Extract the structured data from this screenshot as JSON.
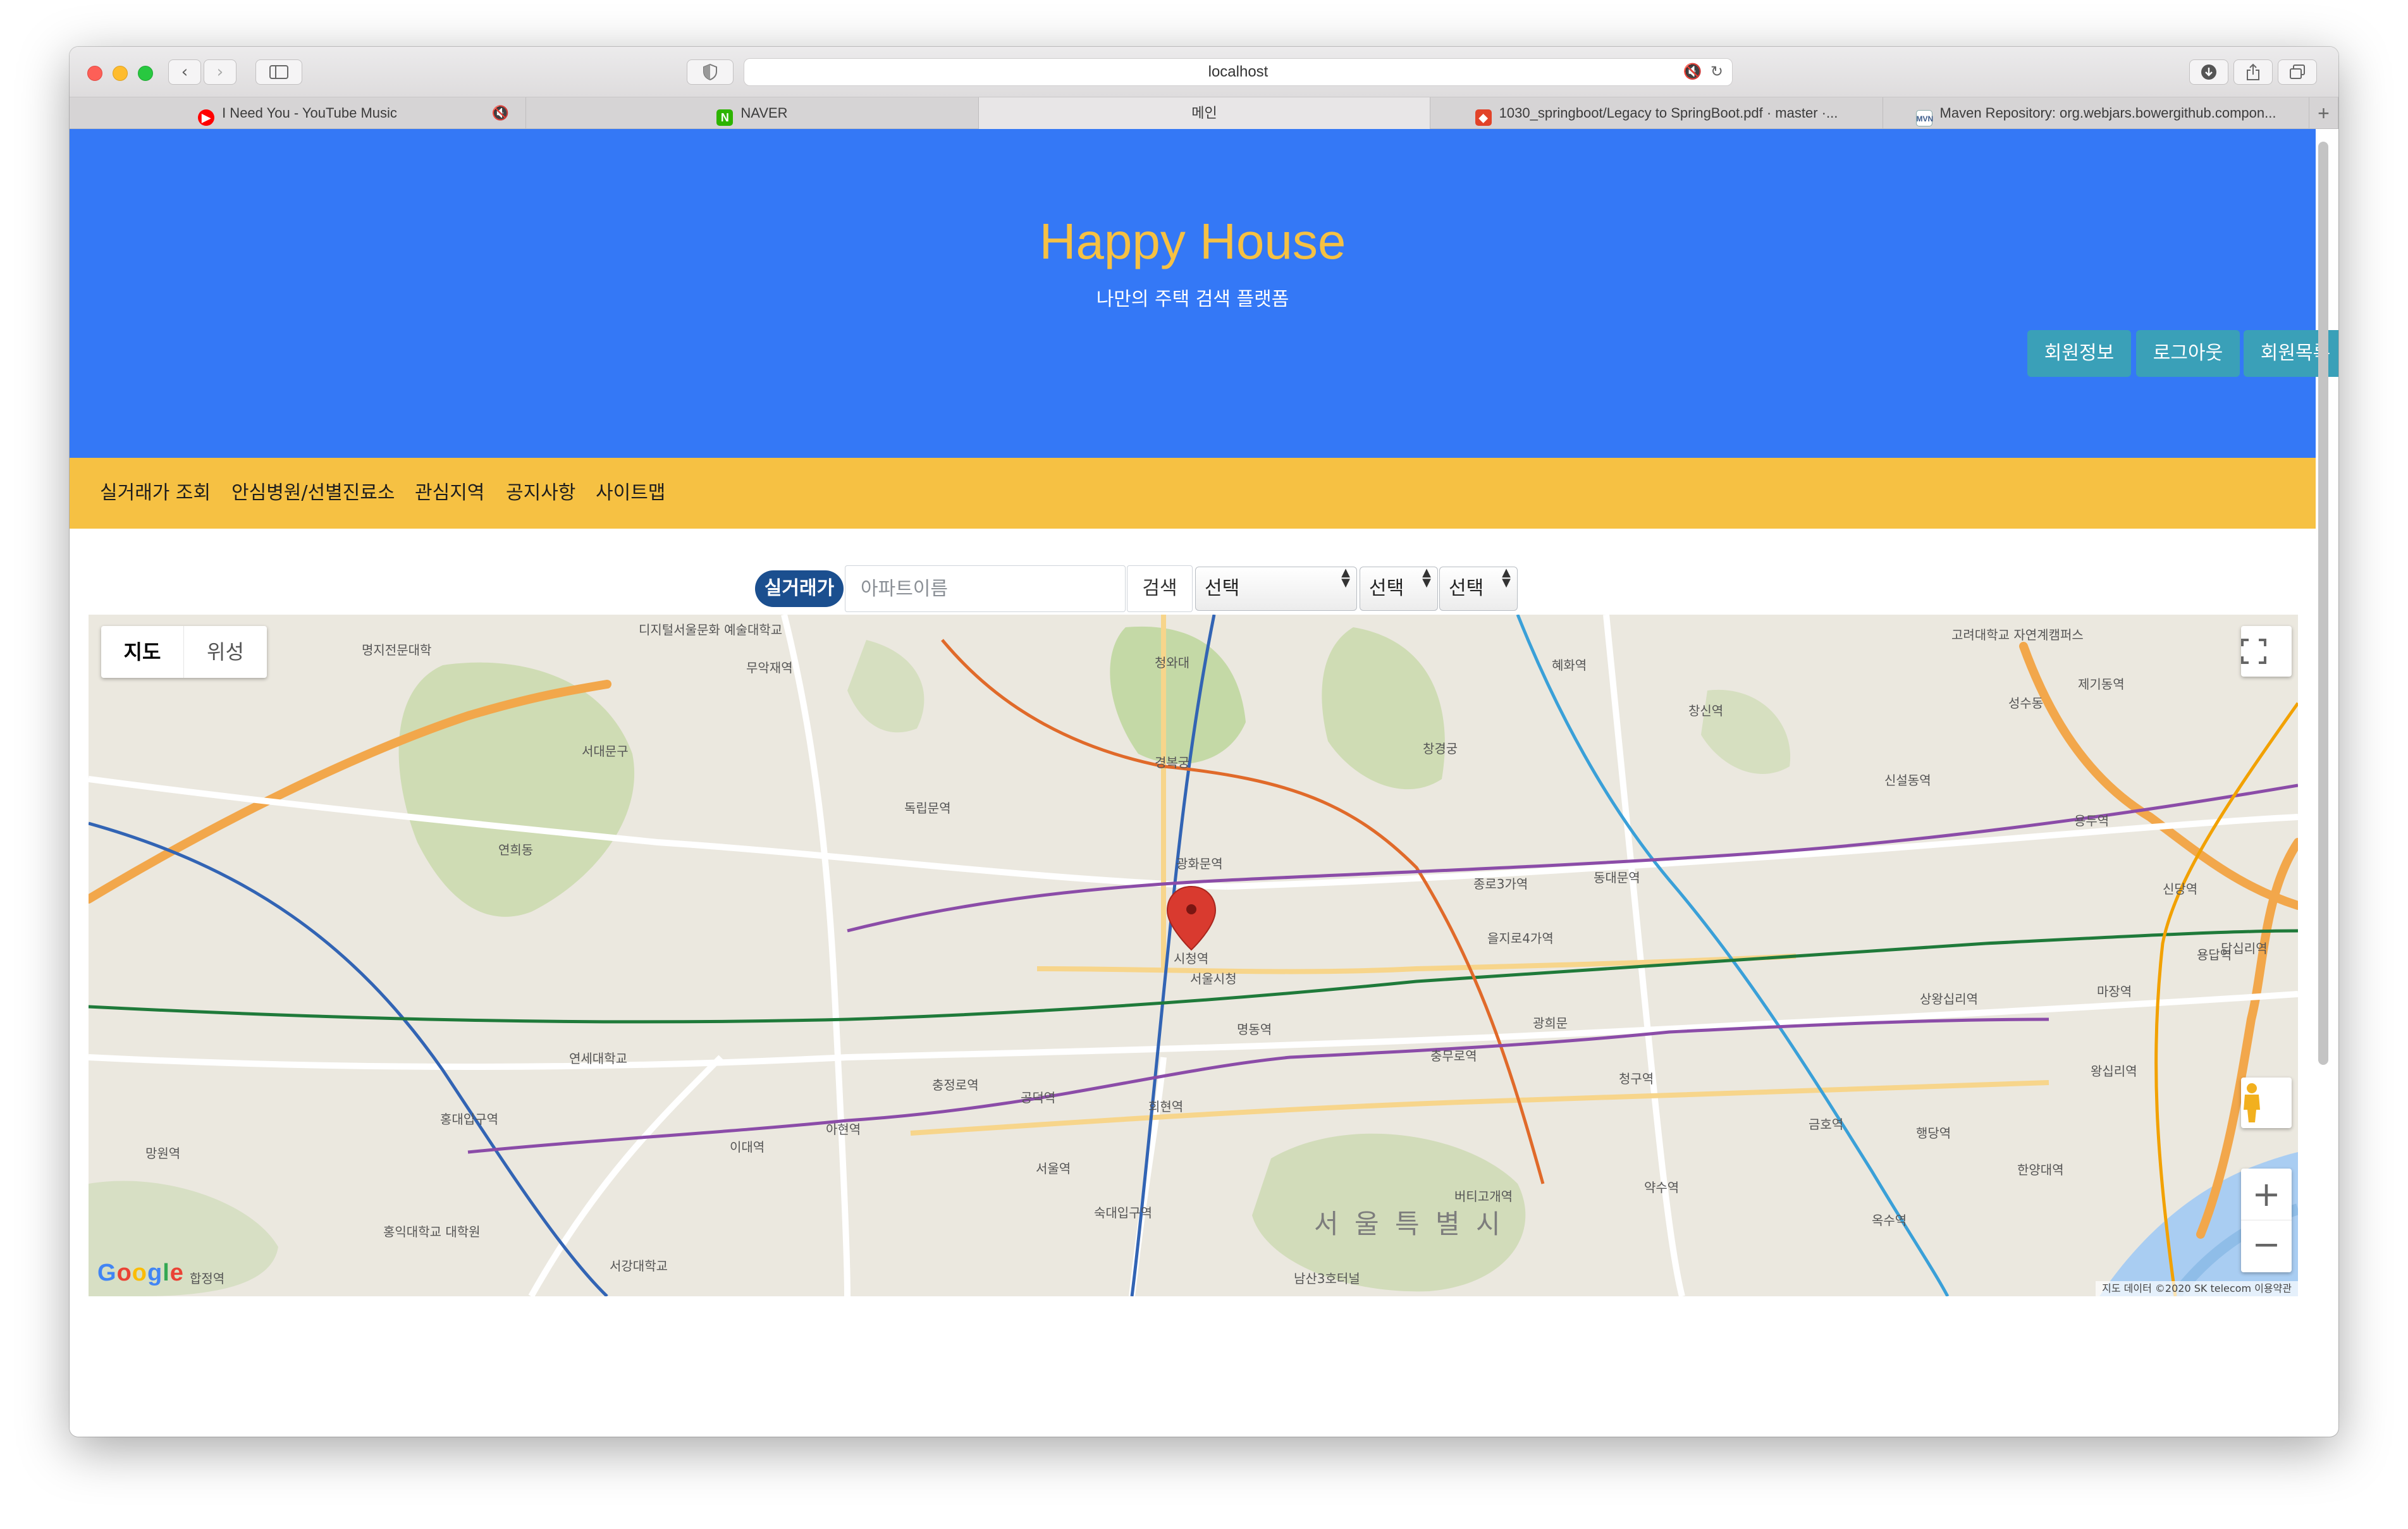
{
  "browser": {
    "address": "localhost",
    "tabs": [
      {
        "label": "I Need You - YouTube Music",
        "muted": true,
        "icon": "youtube-music-icon"
      },
      {
        "label": "NAVER",
        "icon": "naver-icon"
      },
      {
        "label": "메인",
        "active": true
      },
      {
        "label": "1030_springboot/Legacy to SpringBoot.pdf · master ·...",
        "icon": "gitlab-icon"
      },
      {
        "label": "Maven Repository: org.webjars.bowergithub.compon...",
        "icon": "maven-icon"
      }
    ]
  },
  "header": {
    "title": "Happy House",
    "subtitle": "나만의 주택 검색 플랫폼",
    "buttons": [
      "회원정보",
      "로그아웃",
      "회원목록"
    ]
  },
  "nav": {
    "items": [
      "실거래가 조회",
      "안심병원/선별진료소",
      "관심지역",
      "공지사항",
      "사이트맵"
    ]
  },
  "search": {
    "label": "실거래가",
    "placeholder": "아파트이름",
    "button": "검색",
    "selects": [
      "선택",
      "선택",
      "선택"
    ]
  },
  "map": {
    "type_options": [
      "지도",
      "위성"
    ],
    "district": "서 울 특 별 시",
    "labels": [
      "명지전문대학",
      "디지털서울문화 예술대학교",
      "무악재역",
      "독립문역",
      "서대문구",
      "연희동",
      "경복궁",
      "청와대",
      "창경궁",
      "혜화역",
      "창신역",
      "고려대학교 자연계캠퍼스",
      "제기동역",
      "성수동",
      "시청역",
      "광화문역",
      "종로3가역",
      "을지로4가역",
      "동대문역",
      "신당역",
      "청구역",
      "서울역",
      "숙대입구역",
      "아현역",
      "이대역",
      "공덕역",
      "충정로역",
      "회현역",
      "명동역",
      "금호역",
      "옥수역",
      "약수역",
      "버티고개역",
      "합정역",
      "홍대입구역",
      "망원역",
      "서울시청",
      "광희문",
      "충무로역",
      "신설동역",
      "용두역",
      "용답역",
      "한양대역",
      "왕십리역",
      "상왕십리역",
      "행당역",
      "마장역",
      "답십리역",
      "서강대학교",
      "홍익대학교 대학원",
      "연세대학교",
      "남산3호터널"
    ],
    "attribution": "지도 데이터 ©2020 SK telecom   이용약관",
    "logo": "Google"
  }
}
